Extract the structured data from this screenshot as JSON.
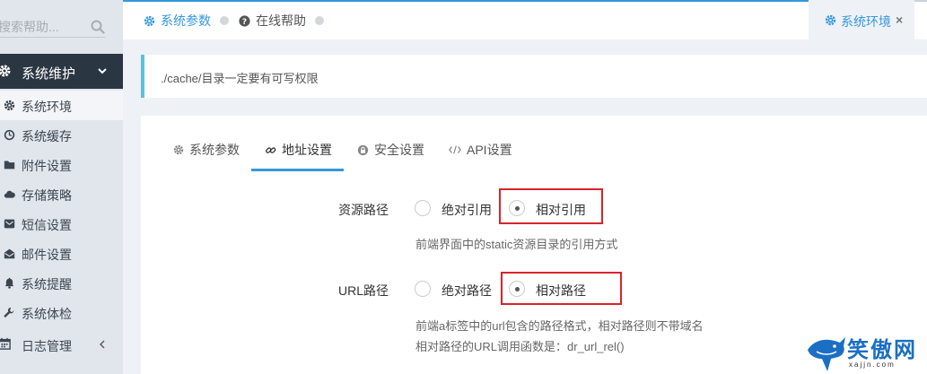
{
  "search": {
    "placeholder": "搜索帮助..."
  },
  "sidebar": {
    "group": {
      "label": "系统维护"
    },
    "items": [
      {
        "label": "系统环境",
        "icon": "gear-icon"
      },
      {
        "label": "系统缓存",
        "icon": "clock-icon"
      },
      {
        "label": "附件设置",
        "icon": "folder-icon"
      },
      {
        "label": "存储策略",
        "icon": "cloud-icon"
      },
      {
        "label": "短信设置",
        "icon": "envelope-square-icon"
      },
      {
        "label": "邮件设置",
        "icon": "envelope-open-icon"
      },
      {
        "label": "系统提醒",
        "icon": "bell-icon"
      },
      {
        "label": "系统体检",
        "icon": "wrench-icon"
      }
    ],
    "log": {
      "label": "日志管理"
    }
  },
  "topbar": {
    "tabs": [
      {
        "label": "系统参数"
      },
      {
        "label": "在线帮助"
      }
    ],
    "active_tab": {
      "label": "系统环境",
      "close": "×"
    }
  },
  "alert": {
    "text": "./cache/目录一定要有可写权限"
  },
  "panel": {
    "tabs": [
      {
        "label": "系统参数"
      },
      {
        "label": "地址设置"
      },
      {
        "label": "安全设置"
      },
      {
        "label": "API设置"
      }
    ],
    "resource_path": {
      "label": "资源路径",
      "options": [
        "绝对引用",
        "相对引用"
      ],
      "selected": "相对引用",
      "help": "前端界面中的static资源目录的引用方式"
    },
    "url_path": {
      "label": "URL路径",
      "options": [
        "绝对路径",
        "相对路径"
      ],
      "selected": "相对路径",
      "help1": "前端a标签中的url包含的路径格式，相对路径则不带域名",
      "help2": "相对路径的URL调用函数是：dr_url_rel()"
    }
  },
  "watermark": {
    "text": "笑傲网",
    "url": "xajjn.com"
  },
  "colors": {
    "accent": "#3598dc",
    "sidebar_dark": "#2b3643",
    "highlight": "#d9232b",
    "alert_border": "#5bc0de"
  }
}
